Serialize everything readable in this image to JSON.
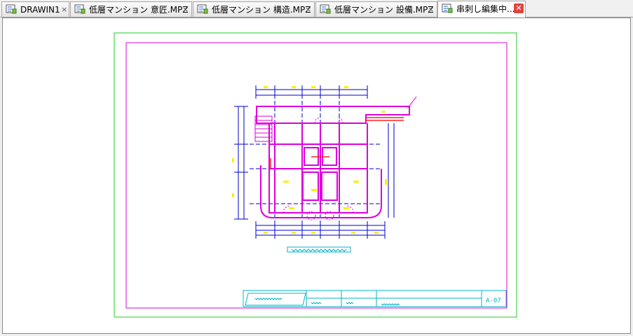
{
  "tabs": [
    {
      "label": "DRAWIN1",
      "close": "×",
      "icon": "cad-document-icon"
    },
    {
      "label": "低層マンション 意匠.MPZ",
      "close": "×",
      "icon": "cad-document-icon"
    },
    {
      "label": "低層マンション 構造.MPZ",
      "close": "×",
      "icon": "cad-document-icon"
    },
    {
      "label": "低層マンション 設備.MPZ",
      "close": "×",
      "icon": "cad-document-icon"
    },
    {
      "label": "串刺し編集中...",
      "close": "✕",
      "icon": "cad-document-icon",
      "active": true
    }
  ],
  "drawing": {
    "sheet_number": "A-07",
    "colors": {
      "outer_frame": "#22cc22",
      "inner_frame": "#dd00dd",
      "wall": "#dd00dd",
      "dimension": "#0000cc",
      "annotation": "#ffee00",
      "title_block": "#00b4c8",
      "accent": "#ff2020"
    }
  }
}
